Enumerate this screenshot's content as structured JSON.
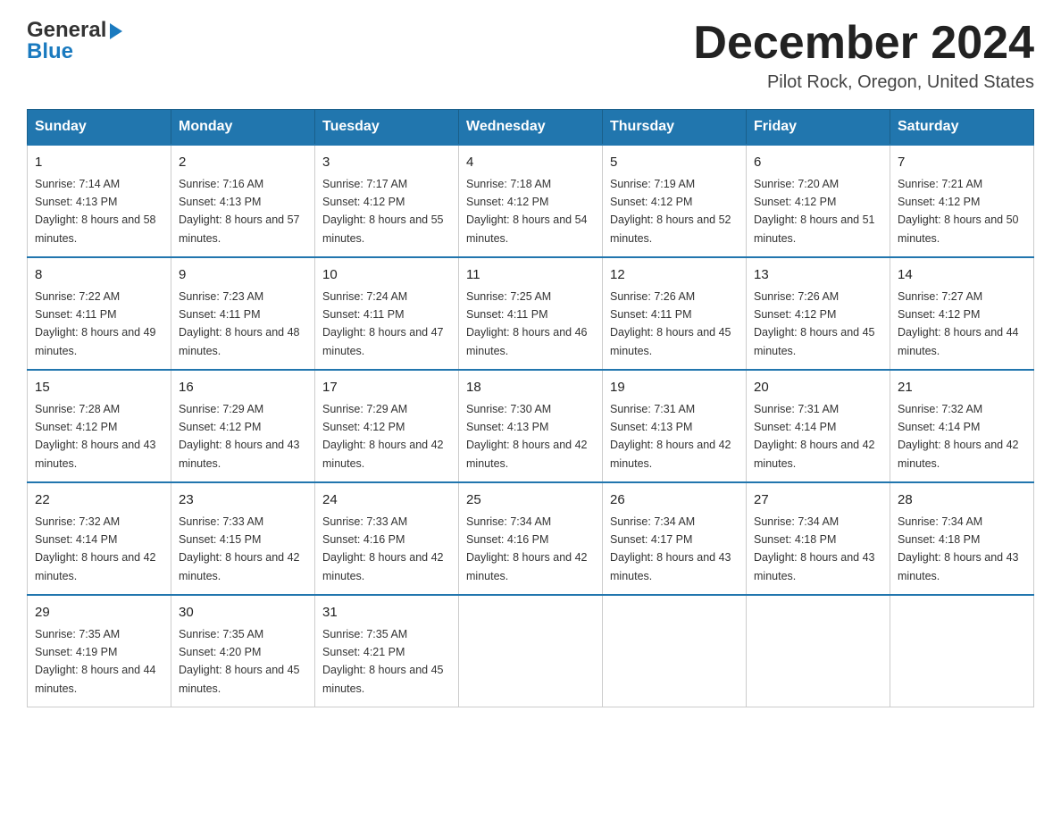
{
  "logo": {
    "line1": "General",
    "arrow": "▶",
    "line2": "Blue"
  },
  "title": "December 2024",
  "location": "Pilot Rock, Oregon, United States",
  "headers": [
    "Sunday",
    "Monday",
    "Tuesday",
    "Wednesday",
    "Thursday",
    "Friday",
    "Saturday"
  ],
  "weeks": [
    [
      {
        "day": "1",
        "sunrise": "7:14 AM",
        "sunset": "4:13 PM",
        "daylight": "8 hours and 58 minutes."
      },
      {
        "day": "2",
        "sunrise": "7:16 AM",
        "sunset": "4:13 PM",
        "daylight": "8 hours and 57 minutes."
      },
      {
        "day": "3",
        "sunrise": "7:17 AM",
        "sunset": "4:12 PM",
        "daylight": "8 hours and 55 minutes."
      },
      {
        "day": "4",
        "sunrise": "7:18 AM",
        "sunset": "4:12 PM",
        "daylight": "8 hours and 54 minutes."
      },
      {
        "day": "5",
        "sunrise": "7:19 AM",
        "sunset": "4:12 PM",
        "daylight": "8 hours and 52 minutes."
      },
      {
        "day": "6",
        "sunrise": "7:20 AM",
        "sunset": "4:12 PM",
        "daylight": "8 hours and 51 minutes."
      },
      {
        "day": "7",
        "sunrise": "7:21 AM",
        "sunset": "4:12 PM",
        "daylight": "8 hours and 50 minutes."
      }
    ],
    [
      {
        "day": "8",
        "sunrise": "7:22 AM",
        "sunset": "4:11 PM",
        "daylight": "8 hours and 49 minutes."
      },
      {
        "day": "9",
        "sunrise": "7:23 AM",
        "sunset": "4:11 PM",
        "daylight": "8 hours and 48 minutes."
      },
      {
        "day": "10",
        "sunrise": "7:24 AM",
        "sunset": "4:11 PM",
        "daylight": "8 hours and 47 minutes."
      },
      {
        "day": "11",
        "sunrise": "7:25 AM",
        "sunset": "4:11 PM",
        "daylight": "8 hours and 46 minutes."
      },
      {
        "day": "12",
        "sunrise": "7:26 AM",
        "sunset": "4:11 PM",
        "daylight": "8 hours and 45 minutes."
      },
      {
        "day": "13",
        "sunrise": "7:26 AM",
        "sunset": "4:12 PM",
        "daylight": "8 hours and 45 minutes."
      },
      {
        "day": "14",
        "sunrise": "7:27 AM",
        "sunset": "4:12 PM",
        "daylight": "8 hours and 44 minutes."
      }
    ],
    [
      {
        "day": "15",
        "sunrise": "7:28 AM",
        "sunset": "4:12 PM",
        "daylight": "8 hours and 43 minutes."
      },
      {
        "day": "16",
        "sunrise": "7:29 AM",
        "sunset": "4:12 PM",
        "daylight": "8 hours and 43 minutes."
      },
      {
        "day": "17",
        "sunrise": "7:29 AM",
        "sunset": "4:12 PM",
        "daylight": "8 hours and 42 minutes."
      },
      {
        "day": "18",
        "sunrise": "7:30 AM",
        "sunset": "4:13 PM",
        "daylight": "8 hours and 42 minutes."
      },
      {
        "day": "19",
        "sunrise": "7:31 AM",
        "sunset": "4:13 PM",
        "daylight": "8 hours and 42 minutes."
      },
      {
        "day": "20",
        "sunrise": "7:31 AM",
        "sunset": "4:14 PM",
        "daylight": "8 hours and 42 minutes."
      },
      {
        "day": "21",
        "sunrise": "7:32 AM",
        "sunset": "4:14 PM",
        "daylight": "8 hours and 42 minutes."
      }
    ],
    [
      {
        "day": "22",
        "sunrise": "7:32 AM",
        "sunset": "4:14 PM",
        "daylight": "8 hours and 42 minutes."
      },
      {
        "day": "23",
        "sunrise": "7:33 AM",
        "sunset": "4:15 PM",
        "daylight": "8 hours and 42 minutes."
      },
      {
        "day": "24",
        "sunrise": "7:33 AM",
        "sunset": "4:16 PM",
        "daylight": "8 hours and 42 minutes."
      },
      {
        "day": "25",
        "sunrise": "7:34 AM",
        "sunset": "4:16 PM",
        "daylight": "8 hours and 42 minutes."
      },
      {
        "day": "26",
        "sunrise": "7:34 AM",
        "sunset": "4:17 PM",
        "daylight": "8 hours and 43 minutes."
      },
      {
        "day": "27",
        "sunrise": "7:34 AM",
        "sunset": "4:18 PM",
        "daylight": "8 hours and 43 minutes."
      },
      {
        "day": "28",
        "sunrise": "7:34 AM",
        "sunset": "4:18 PM",
        "daylight": "8 hours and 43 minutes."
      }
    ],
    [
      {
        "day": "29",
        "sunrise": "7:35 AM",
        "sunset": "4:19 PM",
        "daylight": "8 hours and 44 minutes."
      },
      {
        "day": "30",
        "sunrise": "7:35 AM",
        "sunset": "4:20 PM",
        "daylight": "8 hours and 45 minutes."
      },
      {
        "day": "31",
        "sunrise": "7:35 AM",
        "sunset": "4:21 PM",
        "daylight": "8 hours and 45 minutes."
      },
      null,
      null,
      null,
      null
    ]
  ]
}
